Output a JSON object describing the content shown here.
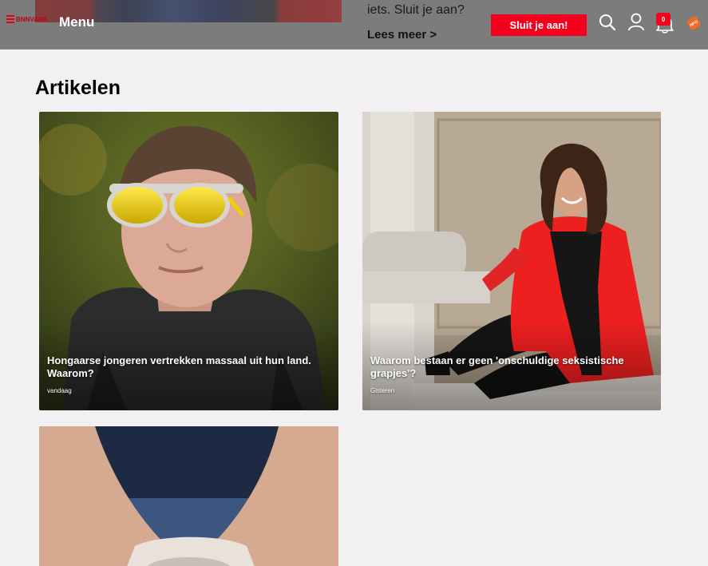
{
  "header": {
    "logo_text": "BNNVARA",
    "menu_label": "Menu",
    "join_label": "Sluit je aan!",
    "behind_text_top": "j...",
    "behind_text": "iets. Sluit je aan?",
    "read_more": "Lees meer >",
    "notification_count": "0",
    "npo_label": "NPO",
    "icons": [
      "hamburger-logo-icon",
      "search-icon",
      "user-icon",
      "bell-icon",
      "npo-icon"
    ],
    "brand_color": "#f4001e"
  },
  "main": {
    "section_title": "Artikelen",
    "articles": [
      {
        "title": "Hongaarse jongeren vertrekken massaal uit hun land. Waarom?",
        "date": "vandaag"
      },
      {
        "title": "Waarom bestaan er geen 'onschuldige seksistische grapjes'?",
        "date": "Gisteren"
      },
      {
        "title": "",
        "date": ""
      }
    ]
  }
}
